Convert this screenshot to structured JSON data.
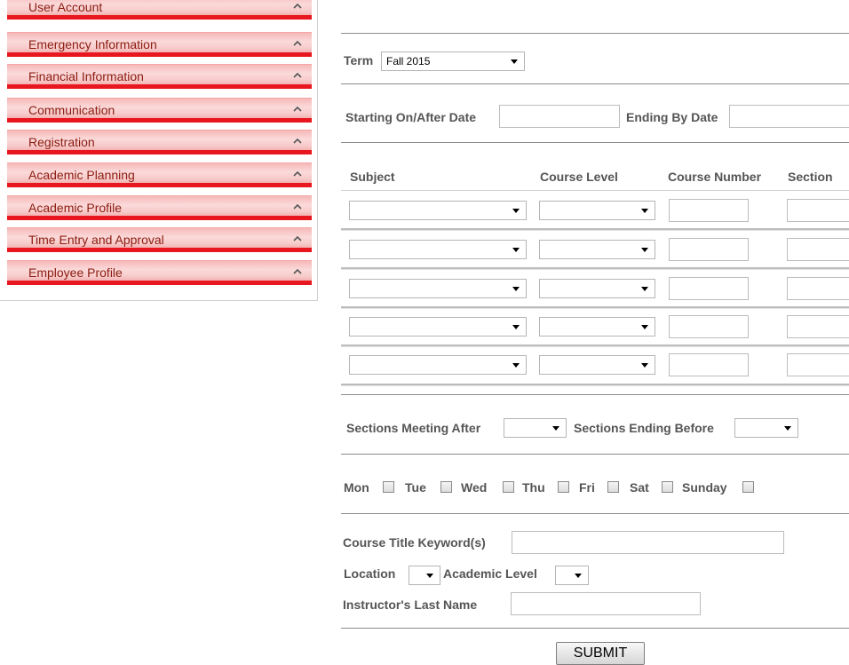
{
  "menu": {
    "items": [
      {
        "label": "User Account"
      },
      {
        "label": "Emergency Information"
      },
      {
        "label": "Financial Information"
      },
      {
        "label": "Communication"
      },
      {
        "label": "Registration"
      },
      {
        "label": "Academic Planning"
      },
      {
        "label": "Academic Profile"
      },
      {
        "label": "Time Entry and Approval"
      },
      {
        "label": "Employee Profile"
      }
    ],
    "caret_icon": "chevron-up-icon",
    "colors": {
      "accent": "#e8161e",
      "text": "#8b1c10",
      "bg_light": "#fbdada"
    }
  },
  "form": {
    "term": {
      "label": "Term",
      "value": "Fall 2015"
    },
    "dates": {
      "start_label": "Starting On/After Date",
      "end_label": "Ending By Date",
      "start_value": "",
      "end_value": ""
    },
    "course_table": {
      "headers": [
        "Subject",
        "Course Level",
        "Course Number",
        "Section"
      ],
      "rows": [
        {
          "subject": "",
          "level": "",
          "number": "",
          "section": ""
        },
        {
          "subject": "",
          "level": "",
          "number": "",
          "section": ""
        },
        {
          "subject": "",
          "level": "",
          "number": "",
          "section": ""
        },
        {
          "subject": "",
          "level": "",
          "number": "",
          "section": ""
        },
        {
          "subject": "",
          "level": "",
          "number": "",
          "section": ""
        }
      ]
    },
    "times": {
      "after_label": "Sections Meeting After",
      "before_label": "Sections Ending Before",
      "after_value": "",
      "before_value": ""
    },
    "days": [
      {
        "label": "Mon",
        "checked": false
      },
      {
        "label": "Tue",
        "checked": false
      },
      {
        "label": "Wed",
        "checked": false
      },
      {
        "label": "Thu",
        "checked": false
      },
      {
        "label": "Fri",
        "checked": false
      },
      {
        "label": "Sat",
        "checked": false
      },
      {
        "label": "Sunday",
        "checked": false
      }
    ],
    "keyword": {
      "label": "Course Title Keyword(s)",
      "value": ""
    },
    "location": {
      "label": "Location",
      "value": ""
    },
    "academic_level": {
      "label": "Academic Level",
      "value": ""
    },
    "instructor": {
      "label": "Instructor's Last Name",
      "value": ""
    },
    "submit_label": "SUBMIT"
  }
}
